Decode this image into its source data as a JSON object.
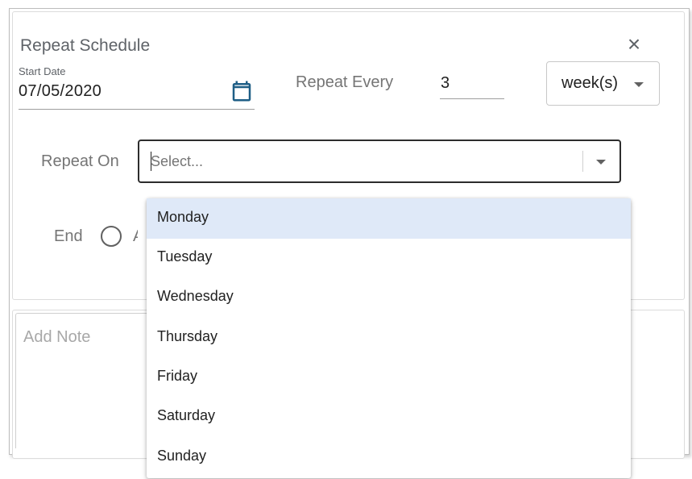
{
  "dialog": {
    "title": "Repeat Schedule",
    "close_symbol": "×",
    "close_icon": "close-icon"
  },
  "start_date": {
    "label": "Start Date",
    "value": "07/05/2020",
    "icon": "calendar-icon",
    "icon_color": "#1e5e86"
  },
  "repeat_every": {
    "label": "Repeat Every",
    "value": "3",
    "unit": "week(s)"
  },
  "repeat_on": {
    "label": "Repeat On",
    "placeholder": "Select...",
    "options": [
      {
        "label": "Monday",
        "highlighted": true
      },
      {
        "label": "Tuesday",
        "highlighted": false
      },
      {
        "label": "Wednesday",
        "highlighted": false
      },
      {
        "label": "Thursday",
        "highlighted": false
      },
      {
        "label": "Friday",
        "highlighted": false
      },
      {
        "label": "Saturday",
        "highlighted": false
      },
      {
        "label": "Sunday",
        "highlighted": false
      }
    ]
  },
  "end": {
    "label": "End",
    "option_partial": "A"
  },
  "note": {
    "placeholder": "Add Note"
  },
  "colors": {
    "highlight": "#dfe9f8",
    "select_border": "#2d2d2d"
  }
}
